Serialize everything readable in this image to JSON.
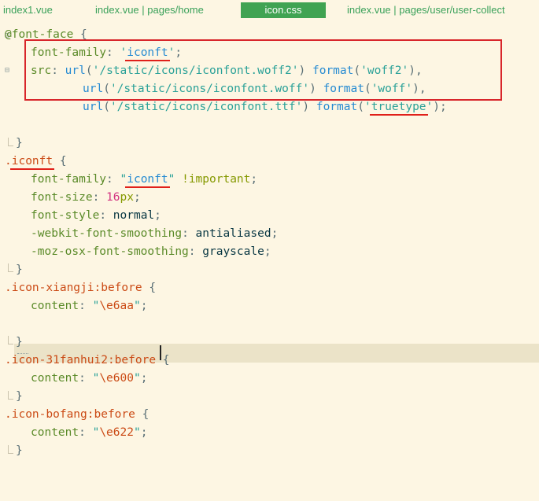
{
  "tabs": [
    {
      "label": "index1.vue"
    },
    {
      "label": "index.vue | pages/home"
    },
    {
      "label": "icon.css"
    },
    {
      "label": "index.vue | pages/user/user-collect"
    }
  ],
  "code": {
    "l1": {
      "at": "@font-face",
      "brace": " {"
    },
    "l2": {
      "prop": "font-family",
      "colon": ": ",
      "q1": "'",
      "val": "iconft",
      "q2": "'",
      "end": ";"
    },
    "l3": {
      "prop": "src",
      "colon": ": ",
      "fn": "url",
      "p1": "(",
      "s": "'/static/icons/iconfont.woff2'",
      "p2": ") ",
      "fmt": "format",
      "p3": "(",
      "fs": "'woff2'",
      "p4": "),"
    },
    "l4": {
      "fn": "url",
      "p1": "(",
      "s": "'/static/icons/iconfont.woff'",
      "p2": ") ",
      "fmt": "format",
      "p3": "(",
      "fs": "'woff'",
      "p4": "),"
    },
    "l5": {
      "fn": "url",
      "p1": "(",
      "s": "'/static/icons/iconfont.ttf'",
      "p2": ") ",
      "fmt": "format",
      "p3": "(",
      "q1": "'",
      "fs": "truetype",
      "q2": "'",
      "p4": ");"
    },
    "l6": {
      "text": "}"
    },
    "l7": {
      "dot": ".",
      "sel": "iconft",
      "brace": " {"
    },
    "l8": {
      "prop": "font-family",
      "colon": ": ",
      "q1": "\"",
      "val": "iconft",
      "q2": "\"",
      "imp": " !important",
      "end": ";"
    },
    "l9": {
      "prop": "font-size",
      "colon": ": ",
      "num": "16",
      "unit": "px",
      "end": ";"
    },
    "l10": {
      "prop": "font-style",
      "colon": ": ",
      "val": "normal",
      "end": ";"
    },
    "l11": {
      "prop": "-webkit-font-smoothing",
      "colon": ": ",
      "val": "antialiased",
      "end": ";"
    },
    "l12": {
      "prop": "-moz-osx-font-smoothing",
      "colon": ": ",
      "val": "grayscale",
      "end": ";"
    },
    "l13": {
      "text": "}"
    },
    "l14": {
      "sel": ".icon-xiangji:before",
      "brace": " {"
    },
    "l15": {
      "prop": "content",
      "colon": ": ",
      "q1": "\"",
      "val": "\\e6aa",
      "q2": "\"",
      "end": ";"
    },
    "l17": {
      "text": "}"
    },
    "l18": {
      "sel": ".icon-31fanhui2:before",
      "brace": " {"
    },
    "l19": {
      "prop": "content",
      "colon": ": ",
      "q1": "\"",
      "val": "\\e600",
      "q2": "\"",
      "end": ";"
    },
    "l20": {
      "text": "}"
    },
    "l21": {
      "sel": ".icon-bofang:before",
      "brace": " {"
    },
    "l22": {
      "prop": "content",
      "colon": ": ",
      "q1": "\"",
      "val": "\\e622",
      "q2": "\"",
      "end": ";"
    },
    "l23": {
      "text": "}"
    }
  },
  "colors": {
    "background": "#fdf6e3",
    "active_tab": "#40a352",
    "highlight_box": "#d8262b"
  }
}
